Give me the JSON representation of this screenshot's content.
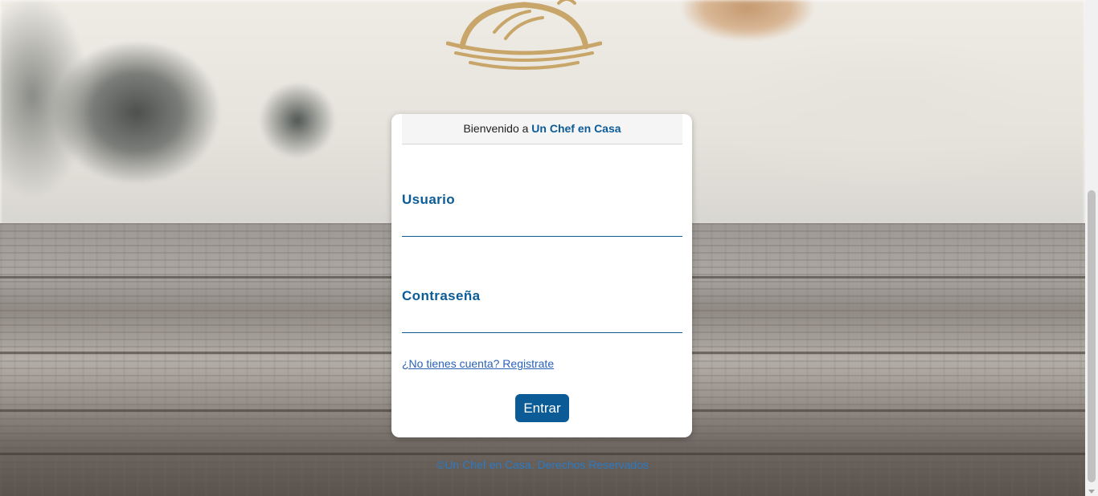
{
  "header": {
    "welcome_prefix": "Bienvenido a",
    "brand_name": "Un Chef en Casa"
  },
  "form": {
    "username_label": "Usuario",
    "username_value": "",
    "password_label": "Contraseña",
    "password_value": "",
    "register_link": "¿No tienes cuenta? Registrate",
    "submit_label": "Entrar"
  },
  "footer": {
    "text": "©Un Chef en Casa. Derechos Reservados"
  },
  "colors": {
    "primary": "#0b5c96",
    "link": "#2a62b8",
    "logo_gold": "#c8a569"
  },
  "icons": {
    "logo": "cloche-icon"
  }
}
